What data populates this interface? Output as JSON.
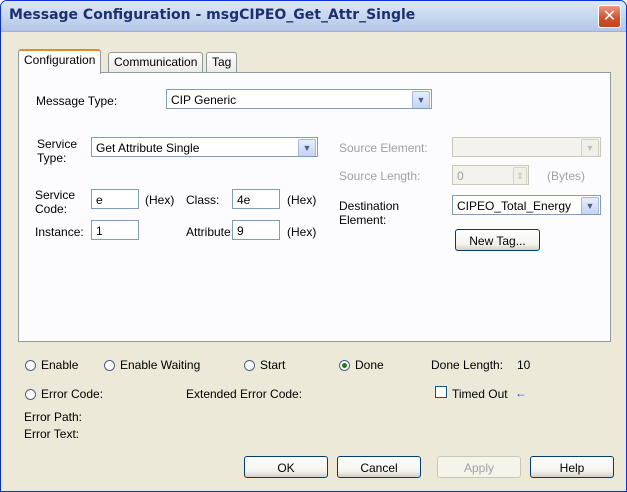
{
  "window": {
    "title": "Message Configuration - msgCIPEO_Get_Attr_Single",
    "close_glyph": "✕"
  },
  "tabs": [
    {
      "label": "Configuration",
      "active": true
    },
    {
      "label": "Communication",
      "active": false
    },
    {
      "label": "Tag",
      "active": false
    }
  ],
  "config": {
    "message_type_label": "Message Type:",
    "message_type_value": "CIP Generic",
    "service_type_label_1": "Service",
    "service_type_label_2": "Type:",
    "service_type_value": "Get Attribute Single",
    "service_code_label_1": "Service",
    "service_code_label_2": "Code:",
    "service_code_value": "e",
    "hex_unit": "(Hex)",
    "class_label": "Class:",
    "class_value": "4e",
    "instance_label": "Instance:",
    "instance_value": "1",
    "attribute_label": "Attribute:",
    "attribute_value": "9",
    "source_element_label": "Source Element:",
    "source_element_value": "",
    "source_length_label": "Source Length:",
    "source_length_value": "0",
    "bytes_unit": "(Bytes)",
    "destination_element_label_1": "Destination",
    "destination_element_label_2": "Element:",
    "destination_element_value": "CIPEO_Total_Energy",
    "new_tag_button": "New Tag..."
  },
  "status": {
    "enable": "Enable",
    "enable_waiting": "Enable Waiting",
    "start": "Start",
    "done": "Done",
    "done_checked": true,
    "done_length_label": "Done Length:",
    "done_length_value": "10",
    "error_code_label": "Error Code:",
    "extended_error_code_label": "Extended Error Code:",
    "timed_out_label": "Timed Out",
    "timed_out_arrow": "←",
    "error_path_label": "Error Path:",
    "error_text_label": "Error Text:"
  },
  "buttons": {
    "ok": "OK",
    "cancel": "Cancel",
    "apply": "Apply",
    "help": "Help"
  },
  "icons": {
    "dropdown_arrow": "✔"
  },
  "colors": {
    "title_text": "#1c2f6e",
    "close_button": "#d2532f",
    "done_radio": "#1f7a1f",
    "timed_out_arrow": "#2a4fd6",
    "disabled_text": "#a0a0a0"
  }
}
